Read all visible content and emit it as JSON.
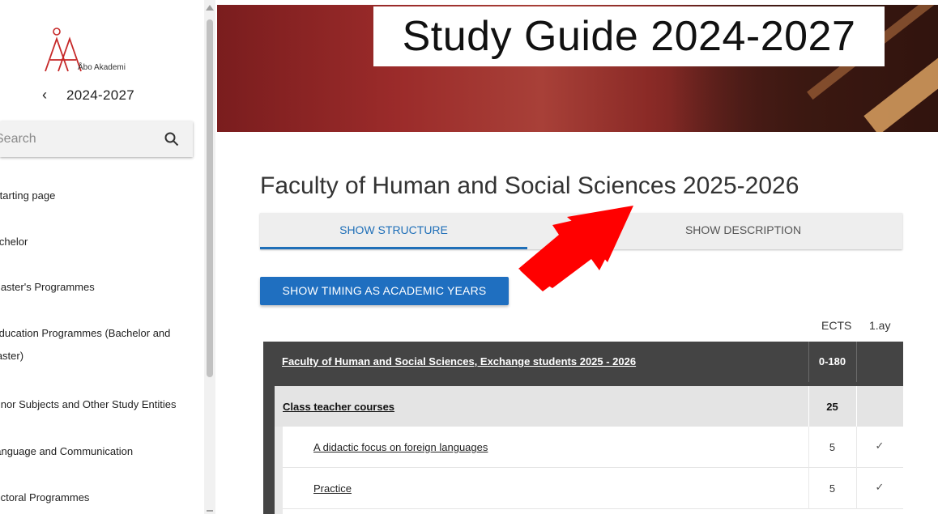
{
  "sidebar": {
    "logo_text": "Åbo Akademi",
    "year": "2024-2027",
    "back_icon": "chevron-left-icon",
    "search": {
      "placeholder": "Search",
      "icon": "search-icon"
    },
    "items": [
      {
        "label": "Starting page"
      },
      {
        "label": "Bachelor"
      },
      {
        "label": "Master's Programmes"
      },
      {
        "label": "Education Programmes (Bachelor and"
      },
      {
        "label": "Master)"
      },
      {
        "label": "Minor Subjects and Other Study Entities"
      },
      {
        "label": "Language and Communication"
      },
      {
        "label": "Doctoral Programmes"
      }
    ]
  },
  "hero": {
    "title": "Study Guide 2024-2027"
  },
  "main": {
    "title": "Faculty of Human and Social Sciences 2025-2026",
    "tabs": [
      {
        "label": "SHOW STRUCTURE",
        "active": true
      },
      {
        "label": "SHOW DESCRIPTION",
        "active": false
      }
    ],
    "timing_button": "SHOW TIMING AS ACADEMIC YEARS",
    "columns": {
      "ects": "ECTS",
      "year1": "1.ay"
    },
    "table": {
      "root": {
        "name": "Faculty of Human and Social Sciences, Exchange students 2025 - 2026",
        "ects": "0-180"
      },
      "group": {
        "name": "Class teacher courses",
        "ects": "25"
      },
      "courses": [
        {
          "name": "A didactic focus on foreign languages",
          "ects": "5",
          "tick": "✓"
        },
        {
          "name": "Practice",
          "ects": "5",
          "tick": "✓"
        }
      ]
    }
  },
  "colors": {
    "accent": "#1f6fc0",
    "table_header": "#444444",
    "arrow": "#ff0000"
  }
}
